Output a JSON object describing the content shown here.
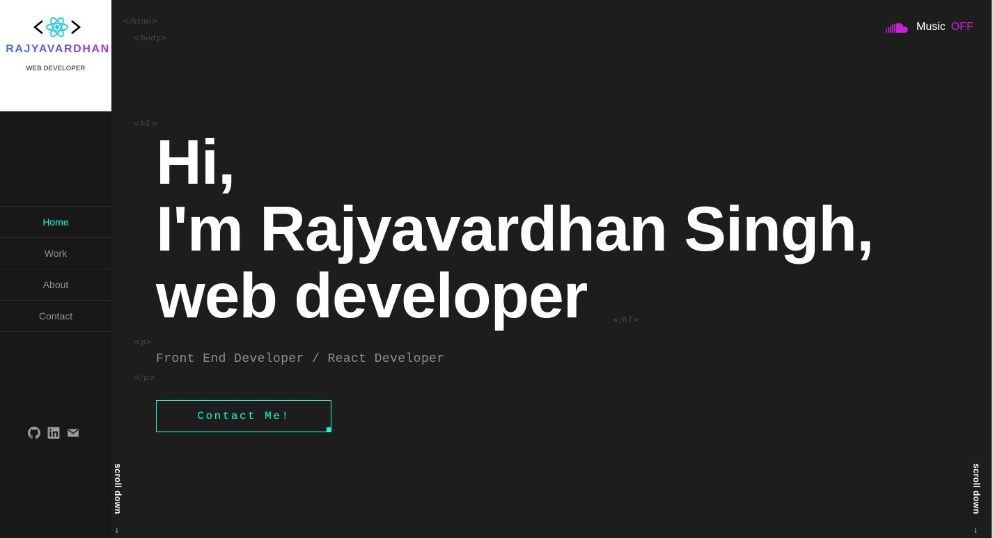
{
  "sidebar": {
    "logo": {
      "name": "RAJYAVARDHAN",
      "subtitle": "WEB DEVELOPER",
      "icon": "react-logo-icon"
    },
    "nav": [
      {
        "label": "Home",
        "active": true
      },
      {
        "label": "Work",
        "active": false
      },
      {
        "label": "About",
        "active": false
      },
      {
        "label": "Contact",
        "active": false
      }
    ],
    "socials": [
      "github-icon",
      "linkedin-icon",
      "mail-icon"
    ]
  },
  "tags": {
    "html_open": "</html>",
    "body_open": "<body>",
    "h1_open": "<h1>",
    "h1_close": "</h1>",
    "p_open": "<p>",
    "p_close": "</p>"
  },
  "hero": {
    "line1": "Hi,",
    "line2": "I'm Rajyavardhan Singh,",
    "line3": "web developer",
    "subtitle": "Front End Developer / React Developer",
    "button": "Contact Me!"
  },
  "music": {
    "label": "Music",
    "state": "OFF",
    "icon": "soundcloud-icon"
  },
  "scroll": {
    "left_label": "scroll down",
    "right_label": "scroll down"
  },
  "colors": {
    "accent": "#08fdd8",
    "music_accent": "#cc1fdd",
    "background": "#1d1d1d",
    "sidebar": "#181818"
  }
}
